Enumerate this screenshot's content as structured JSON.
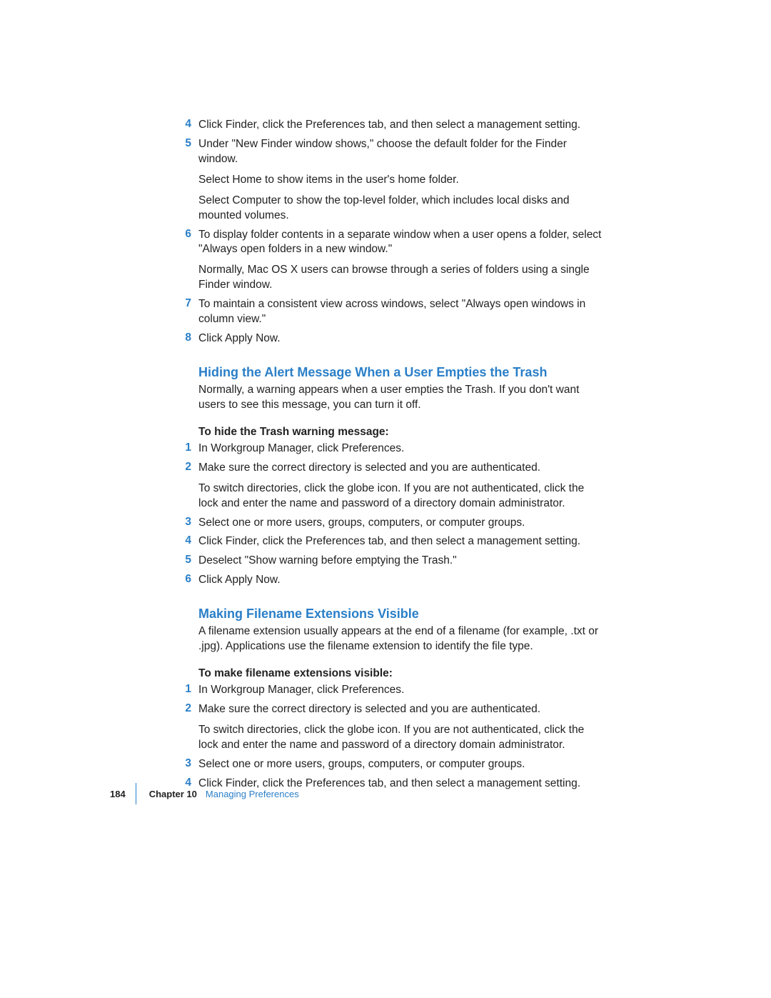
{
  "top_steps": [
    {
      "num": "4",
      "paras": [
        "Click Finder, click the Preferences tab, and then select a management setting."
      ]
    },
    {
      "num": "5",
      "paras": [
        "Under \"New Finder window shows,\" choose the default folder for the Finder window.",
        "Select Home to show items in the user's home folder.",
        "Select Computer to show the top-level folder, which includes local disks and mounted volumes."
      ]
    },
    {
      "num": "6",
      "paras": [
        "To display folder contents in a separate window when a user opens a folder, select \"Always open folders in a new window.\"",
        "Normally, Mac OS X users can browse through a series of folders using a single Finder window."
      ]
    },
    {
      "num": "7",
      "paras": [
        "To maintain a consistent view across windows, select \"Always open windows in column view.\""
      ]
    },
    {
      "num": "8",
      "paras": [
        "Click Apply Now."
      ]
    }
  ],
  "section1": {
    "heading": "Hiding the Alert Message When a User Empties the Trash",
    "intro": "Normally, a warning appears when a user empties the Trash. If you don't want users to see this message, you can turn it off.",
    "task": "To hide the Trash warning message:",
    "steps": [
      {
        "num": "1",
        "paras": [
          "In Workgroup Manager, click Preferences."
        ]
      },
      {
        "num": "2",
        "paras": [
          "Make sure the correct directory is selected and you are authenticated.",
          "To switch directories, click the globe icon. If you are not authenticated, click the lock and enter the name and password of a directory domain administrator."
        ]
      },
      {
        "num": "3",
        "paras": [
          "Select one or more users, groups, computers, or computer groups."
        ]
      },
      {
        "num": "4",
        "paras": [
          "Click Finder, click the Preferences tab, and then select a management setting."
        ]
      },
      {
        "num": "5",
        "paras": [
          "Deselect \"Show warning before emptying the Trash.\""
        ]
      },
      {
        "num": "6",
        "paras": [
          "Click Apply Now."
        ]
      }
    ]
  },
  "section2": {
    "heading": "Making Filename Extensions Visible",
    "intro": "A filename extension usually appears at the end of a filename (for example, .txt or .jpg). Applications use the filename extension to identify the file type.",
    "task": "To make filename extensions visible:",
    "steps": [
      {
        "num": "1",
        "paras": [
          "In Workgroup Manager, click Preferences."
        ]
      },
      {
        "num": "2",
        "paras": [
          "Make sure the correct directory is selected and you are authenticated.",
          "To switch directories, click the globe icon. If you are not authenticated, click the lock and enter the name and password of a directory domain administrator."
        ]
      },
      {
        "num": "3",
        "paras": [
          "Select one or more users, groups, computers, or computer groups."
        ]
      },
      {
        "num": "4",
        "paras": [
          "Click Finder, click the Preferences tab, and then select a management setting."
        ]
      }
    ]
  },
  "footer": {
    "page_number": "184",
    "chapter_label": "Chapter 10",
    "chapter_title": "Managing Preferences"
  }
}
